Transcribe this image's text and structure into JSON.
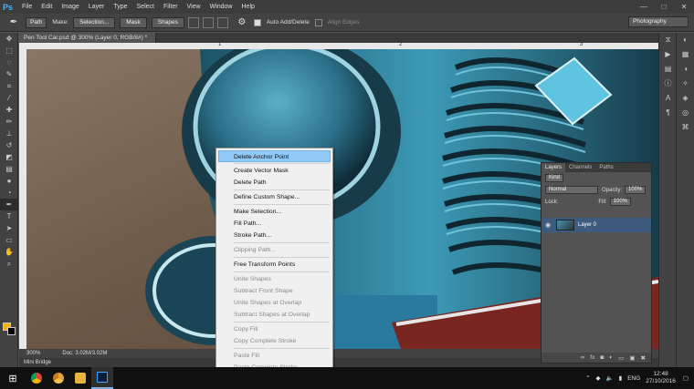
{
  "app": {
    "logo": "Ps",
    "menu": [
      "File",
      "Edit",
      "Image",
      "Layer",
      "Type",
      "Select",
      "Filter",
      "View",
      "Window",
      "Help"
    ],
    "window_controls": [
      "—",
      "□",
      "✕"
    ]
  },
  "options_bar": {
    "mode": "Path",
    "make_label": "Make:",
    "selection_btn": "Selection...",
    "mask_btn": "Mask",
    "shapes_btn": "Shapes",
    "auto_add_delete": "Auto Add/Delete",
    "align_edges": "Align Edges",
    "workspace": "Photography"
  },
  "document": {
    "tab_title": "Pen Tool Car.psd @ 300% (Layer 0, RGB/8#) *",
    "ruler_marks": [
      "1",
      "2",
      "3"
    ],
    "zoom": "300%",
    "doc_info": "Doc: 3.02M/3.02M",
    "mini_bridge": "Mini Bridge"
  },
  "context_menu": {
    "groups": [
      [
        "Delete Anchor Point"
      ],
      [
        "Create Vector Mask",
        "Delete Path"
      ],
      [
        "Define Custom Shape..."
      ],
      [
        "Make Selection...",
        "Fill Path...",
        "Stroke Path..."
      ],
      [
        "Clipping Path..."
      ],
      [
        "Free Transform Points"
      ],
      [
        "Unite Shapes",
        "Subtract Front Shape",
        "Unite Shapes at Overlap",
        "Subtract Shapes at Overlap"
      ],
      [
        "Copy Fill",
        "Copy Complete Stroke"
      ],
      [
        "Paste Fill",
        "Paste Complete Stroke"
      ]
    ],
    "disabled": [
      "Clipping Path...",
      "Unite Shapes",
      "Subtract Front Shape",
      "Unite Shapes at Overlap",
      "Subtract Shapes at Overlap",
      "Copy Fill",
      "Copy Complete Stroke",
      "Paste Fill",
      "Paste Complete Stroke"
    ],
    "highlighted": "Delete Anchor Point"
  },
  "layers_panel": {
    "tabs": [
      "Layers",
      "Channels",
      "Paths"
    ],
    "kind": "Kind",
    "blend_mode": "Normal",
    "opacity_label": "Opacity:",
    "opacity": "100%",
    "lock_label": "Lock:",
    "fill_label": "Fill:",
    "fill": "100%",
    "layer_name": "Layer 0"
  },
  "taskbar": {
    "language": "ENG",
    "time": "12:48",
    "date": "27/10/2016"
  },
  "colors": {
    "foreground": "#f0b400",
    "background": "#000000",
    "menu_highlight": "#91c9f7"
  }
}
